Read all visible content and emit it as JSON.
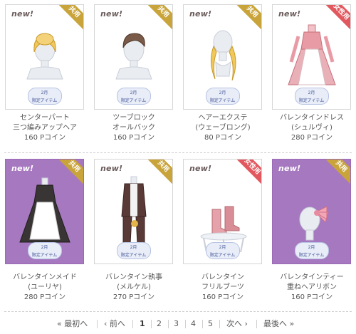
{
  "items": [
    {
      "new_label": "new!",
      "tag": "共用",
      "tag_color": "#c9a43a",
      "badge_top": "2月",
      "badge_bottom": "限定アイテム",
      "line1": "センターパート",
      "line2": "三つ編みアップヘア",
      "price": "160 Pコイン",
      "bg": "white"
    },
    {
      "new_label": "new!",
      "tag": "共用",
      "tag_color": "#c9a43a",
      "badge_top": "2月",
      "badge_bottom": "限定アイテム",
      "line1": "ツーブロック",
      "line2": "オールバック",
      "price": "160 Pコイン",
      "bg": "white"
    },
    {
      "new_label": "new!",
      "tag": "共用",
      "tag_color": "#c9a43a",
      "badge_top": "2月",
      "badge_bottom": "限定アイテム",
      "line1": "ヘアーエクステ",
      "line2": "(ウェーブロング)",
      "price": "80 Pコイン",
      "bg": "white"
    },
    {
      "new_label": "new!",
      "tag": "女性用",
      "tag_color": "#e2585f",
      "badge_top": "2月",
      "badge_bottom": "限定アイテム",
      "line1": "バレンタインドレス",
      "line2": "(シュルヴィ)",
      "price": "280 Pコイン",
      "bg": "white"
    },
    {
      "new_label": "new!",
      "tag": "共用",
      "tag_color": "#c9a43a",
      "badge_top": "2月",
      "badge_bottom": "限定アイテム",
      "line1": "バレンタインメイド",
      "line2": "(ユーリヤ)",
      "price": "280 Pコイン",
      "bg": "purple"
    },
    {
      "new_label": "new!",
      "tag": "共用",
      "tag_color": "#c9a43a",
      "badge_top": "2月",
      "badge_bottom": "限定アイテム",
      "line1": "バレンタイン執事",
      "line2": "(メルケル)",
      "price": "270 Pコイン",
      "bg": "white"
    },
    {
      "new_label": "new!",
      "tag": "女性用",
      "tag_color": "#e2585f",
      "badge_top": "2月",
      "badge_bottom": "限定アイテム",
      "line1": "バレンタイン",
      "line2": "フリルブーツ",
      "price": "160 Pコイン",
      "bg": "white"
    },
    {
      "new_label": "new!",
      "tag": "共用",
      "tag_color": "#c9a43a",
      "badge_top": "2月",
      "badge_bottom": "限定アイテム",
      "line1": "バレンタインティー",
      "line2": "重ねヘアリボン",
      "price": "160 Pコイン",
      "bg": "purple"
    }
  ],
  "pagination": {
    "first": "« 最初へ",
    "prev": "‹ 前へ",
    "pages": [
      "1",
      "2",
      "3",
      "4",
      "5"
    ],
    "current": "1",
    "next": "次へ ›",
    "last": "最後へ »"
  }
}
